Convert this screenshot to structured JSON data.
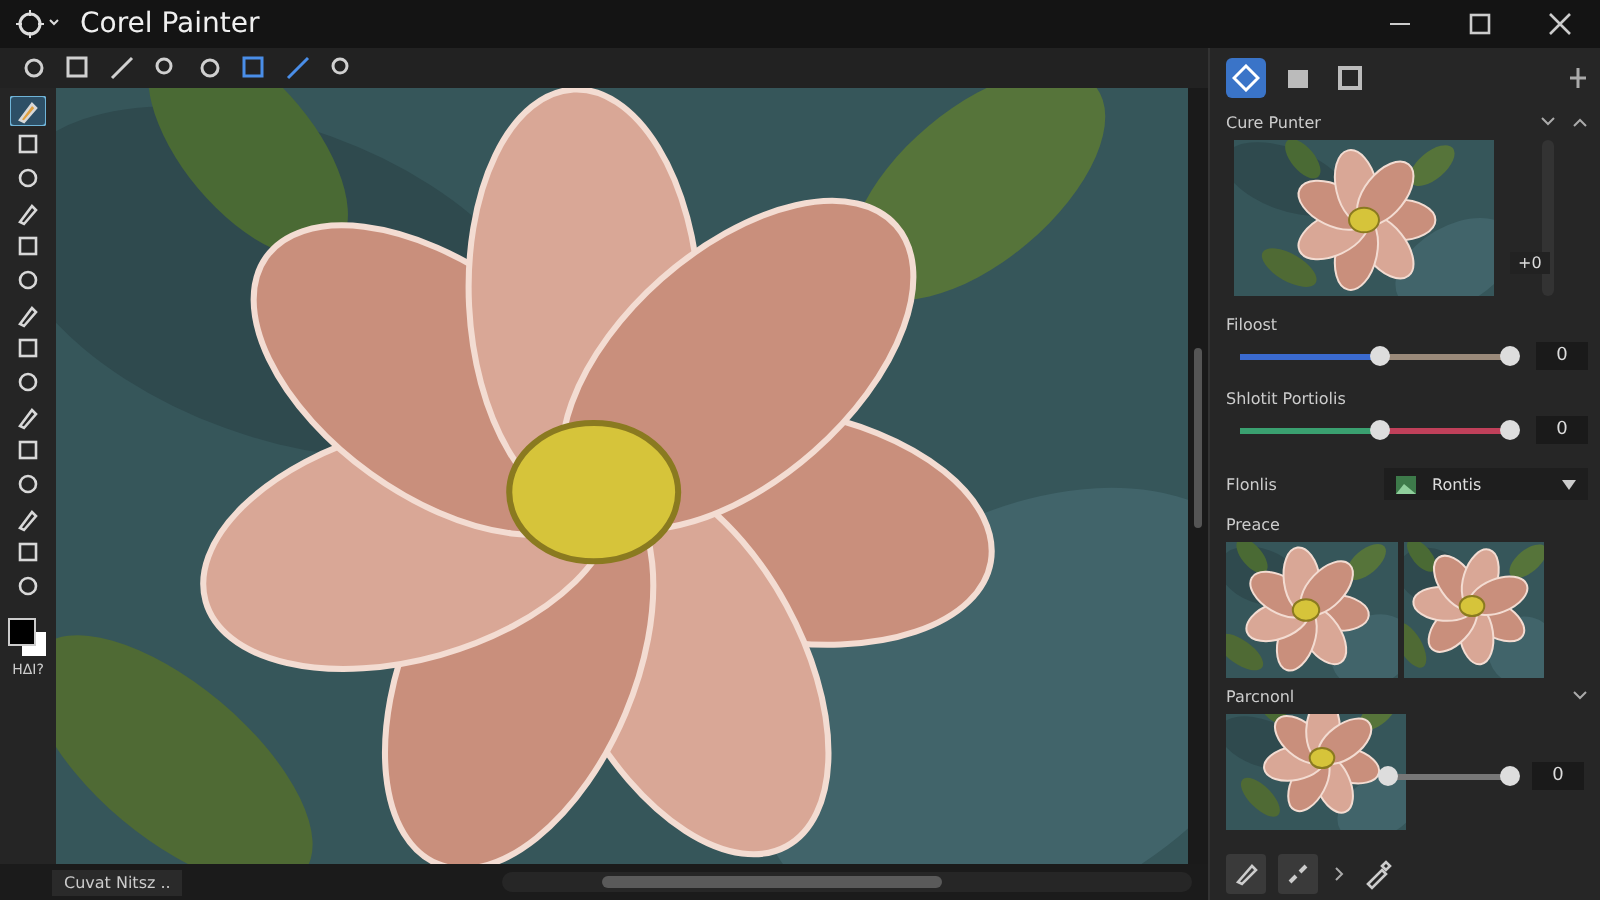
{
  "window": {
    "title": "Corel Painter"
  },
  "toolbar": {
    "tools": [
      {
        "selected": false
      },
      {
        "selected": false
      },
      {
        "selected": false
      },
      {
        "selected": false
      },
      {
        "selected": false
      },
      {
        "selected": true
      },
      {
        "selected": true
      },
      {
        "selected": false
      }
    ]
  },
  "toolbox": {
    "tools": [
      {
        "selected": true
      },
      {
        "selected": false
      },
      {
        "selected": false
      },
      {
        "selected": false
      },
      {
        "selected": false
      },
      {
        "selected": false
      },
      {
        "selected": false
      },
      {
        "selected": false
      },
      {
        "selected": false
      },
      {
        "selected": false
      },
      {
        "selected": false
      },
      {
        "selected": false
      },
      {
        "selected": false
      },
      {
        "selected": false
      },
      {
        "selected": false
      }
    ],
    "swatch_label": "ΗΔΙ?"
  },
  "status_bar": {
    "document_tab": "Cuvat Nitsz .."
  },
  "panel": {
    "tabs": [
      {
        "selected": true
      },
      {
        "selected": false
      },
      {
        "selected": false
      }
    ],
    "header": "Cure Punter",
    "preview_badge": "+0",
    "sliders": [
      {
        "label": "Filoost",
        "level": 0.52,
        "value": "0",
        "kind": "blue"
      },
      {
        "label": "Shlotit Portiolis",
        "level": 0.52,
        "value": "0",
        "kind": "green"
      }
    ],
    "dropdown": {
      "label": "Flonlis",
      "value": "Rontis"
    },
    "presets_title": "Preace",
    "section_title": "Parcnonl",
    "section_slider": {
      "level": 0,
      "value": "0"
    }
  }
}
